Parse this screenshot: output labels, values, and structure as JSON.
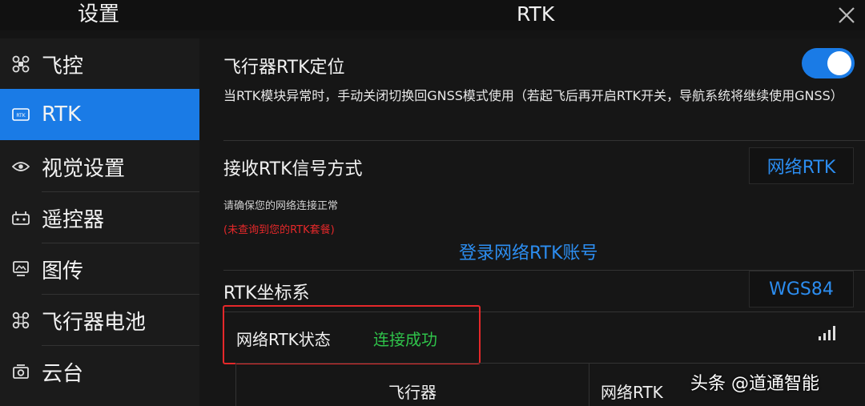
{
  "header": {
    "settings_title": "设置",
    "page_title": "RTK"
  },
  "sidebar": {
    "items": [
      {
        "label": "飞控",
        "icon": "drone-icon",
        "active": false
      },
      {
        "label": "RTK",
        "icon": "rtk-icon",
        "active": true
      },
      {
        "label": "视觉设置",
        "icon": "eye-icon",
        "active": false
      },
      {
        "label": "遥控器",
        "icon": "remote-controller-icon",
        "active": false
      },
      {
        "label": "图传",
        "icon": "image-transmission-icon",
        "active": false
      },
      {
        "label": "飞行器电池",
        "icon": "aircraft-battery-icon",
        "active": false
      },
      {
        "label": "云台",
        "icon": "gimbal-camera-icon",
        "active": false
      }
    ]
  },
  "main": {
    "rtk_positioning": {
      "title": "飞行器RTK定位",
      "enabled": true,
      "description": "当RTK模块异常时，手动关闭切换回GNSS模式使用（若起飞后再开启RTK开关，导航系统将继续使用GNSS）"
    },
    "receive_method": {
      "title": "接收RTK信号方式",
      "value": "网络RTK",
      "note": "请确保您的网络连接正常",
      "warning": "(未查询到您的RTK套餐)",
      "login_link": "登录网络RTK账号"
    },
    "coordinate_system": {
      "title": "RTK坐标系",
      "value": "WGS84"
    },
    "network_status": {
      "label": "网络RTK状态",
      "value": "连接成功"
    },
    "table": {
      "headers": [
        "飞行器",
        "网络RTK"
      ]
    }
  },
  "watermark": "头条 @道通智能",
  "colors": {
    "accent": "#1a7be6",
    "link": "#2c8df0",
    "warning": "#e5282a",
    "success": "#2fc24a"
  }
}
